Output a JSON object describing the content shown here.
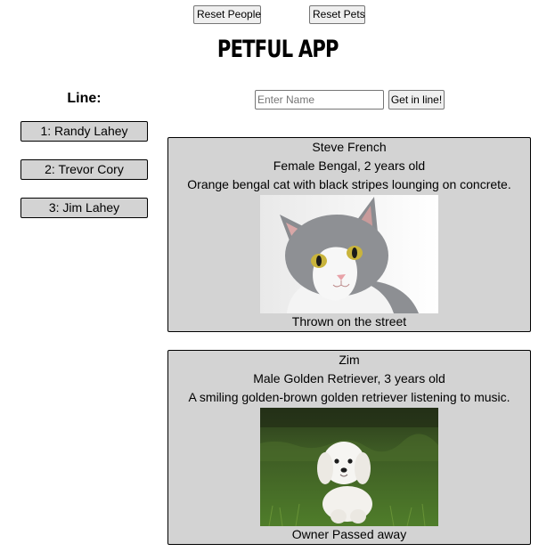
{
  "controls": {
    "reset_people_label": "Reset People",
    "reset_pets_label": "Reset Pets"
  },
  "app": {
    "title": "PETFUL APP"
  },
  "queue": {
    "label": "Line:",
    "people": [
      "1: Randy Lahey",
      "2: Trevor Cory",
      "3: Jim Lahey"
    ]
  },
  "join": {
    "placeholder": "Enter Name",
    "button_label": "Get in line!"
  },
  "pets": [
    {
      "name": "Steve French",
      "details": "Female Bengal, 2 years old",
      "description": "Orange bengal cat with black stripes lounging on concrete.",
      "story": "Thrown on the street",
      "photo": "cat-photo"
    },
    {
      "name": "Zim",
      "details": "Male Golden Retriever, 3 years old",
      "description": "A smiling golden-brown golden retriever listening to music.",
      "story": "Owner Passed away",
      "photo": "dog-photo"
    }
  ]
}
